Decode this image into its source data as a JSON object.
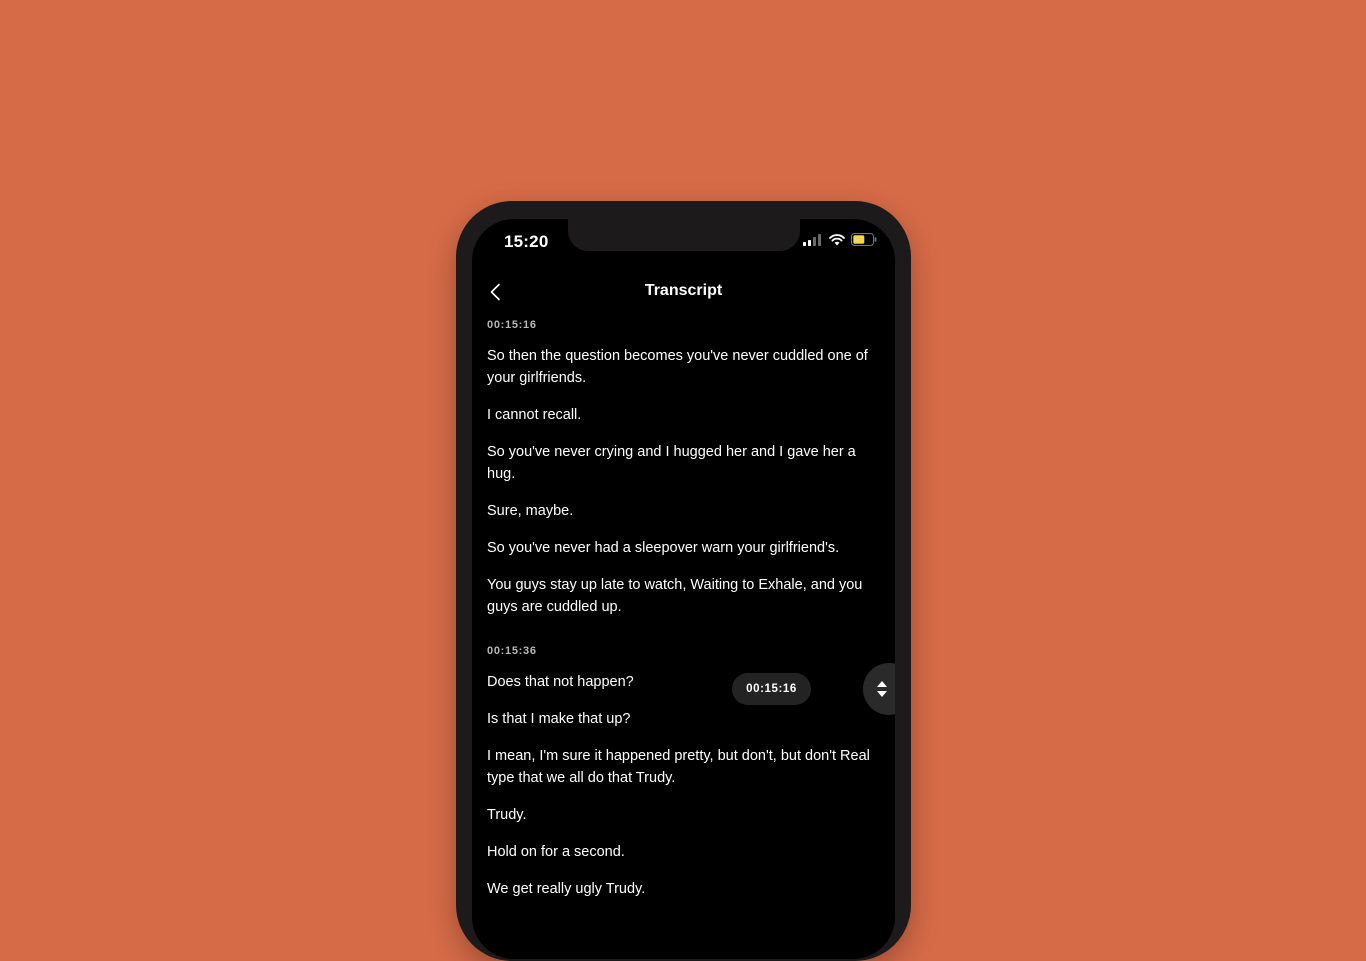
{
  "status_bar": {
    "time": "15:20",
    "signal_icon": "cellular-signal-icon",
    "wifi_icon": "wifi-icon",
    "battery_icon": "battery-icon",
    "battery_color": "#F5D64A"
  },
  "header": {
    "back_icon": "chevron-left-icon",
    "title": "Transcript"
  },
  "transcript": [
    {
      "timestamp": "00:15:16",
      "lines": [
        "So then the question becomes you've never cuddled one of your girlfriends.",
        "I cannot recall.",
        "So you've never crying and I hugged her and I gave her a hug.",
        "Sure, maybe.",
        "So you've never had a sleepover warn your girlfriend's.",
        "You guys stay up late to watch, Waiting to Exhale, and you guys are cuddled up."
      ]
    },
    {
      "timestamp": "00:15:36",
      "lines": [
        "Does that not happen?",
        "Is that I make that up?",
        "I mean, I'm sure it happened pretty, but don't, but don't Real type that we all do that Trudy.",
        "Trudy.",
        "Hold on for a second.",
        "We get really ugly Trudy."
      ]
    }
  ],
  "scrubber": {
    "current_time": "00:15:16",
    "handle_icon": "up-down-arrows-icon"
  },
  "colors": {
    "background": "#D66B47",
    "phone_frame": "#1C1A1A",
    "screen": "#000000",
    "timestamp_text": "#B8B8B8"
  }
}
